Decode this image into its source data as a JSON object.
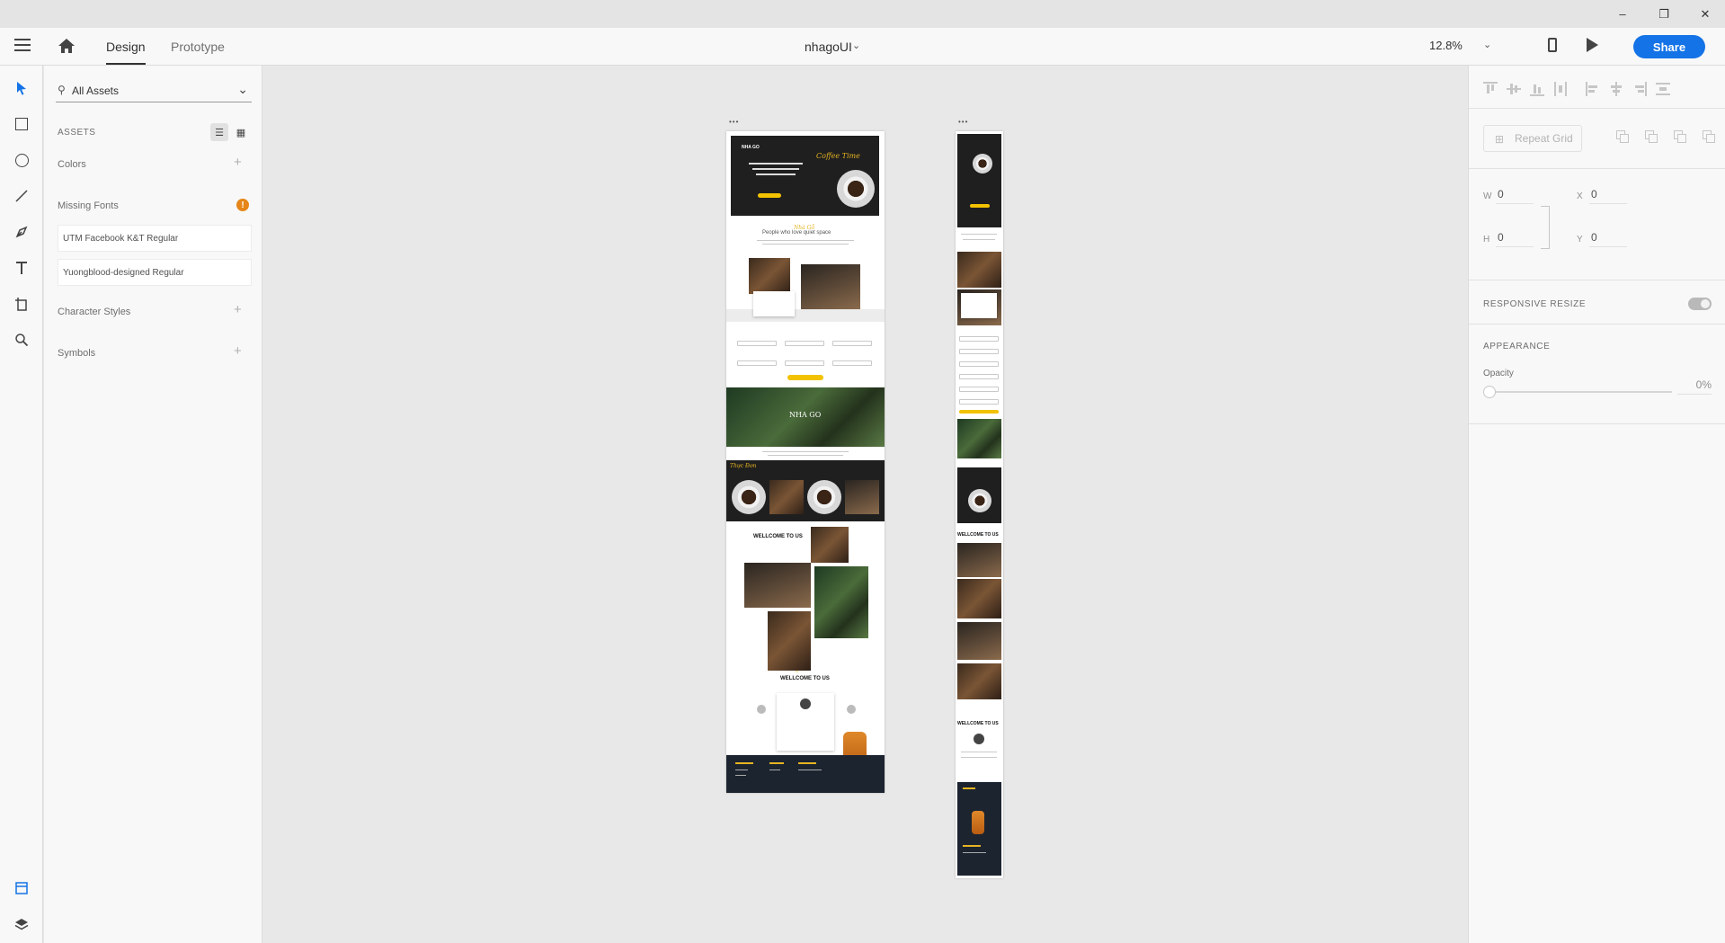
{
  "window": {
    "controls": {
      "minimize": "–",
      "restore": "❐",
      "close": "✕"
    }
  },
  "appbar": {
    "tabs": [
      {
        "label": "Design",
        "active": true
      },
      {
        "label": "Prototype",
        "active": false
      }
    ],
    "document_title": "nhagoUI",
    "zoom": "12.8%",
    "share_label": "Share",
    "accent_color": "#1473e6"
  },
  "toolbar": {
    "tools": [
      "select-tool",
      "rectangle-tool",
      "ellipse-tool",
      "line-tool",
      "pen-tool",
      "text-tool",
      "artboard-tool",
      "zoom-tool"
    ],
    "bottom": [
      "assets-panel",
      "layers-panel"
    ]
  },
  "assets": {
    "filter": "All Assets",
    "heading": "ASSETS",
    "colors_label": "Colors",
    "missing_fonts_label": "Missing Fonts",
    "missing_fonts": [
      "UTM Facebook K&T Regular",
      "Yuongblood-designed Regular"
    ],
    "character_styles_label": "Character Styles",
    "symbols_label": "Symbols",
    "warning_color": "#e68619"
  },
  "canvas": {
    "desktop_artboard": {
      "hero_script": "Coffee Time",
      "brand": "Nhà Gỗ",
      "tagline": "People who love quiet space",
      "logo": "NHA GO",
      "menu_title": "Thực Đơn",
      "welcome_1": "WELLCOME TO US",
      "welcome_2": "WELLCOME TO US"
    },
    "mobile_artboard": {
      "welcome_1": "WELLCOME TO US",
      "welcome_2": "WELLCOME TO US"
    }
  },
  "properties": {
    "repeat_grid_label": "Repeat Grid",
    "w_label": "W",
    "w_value": "0",
    "h_label": "H",
    "h_value": "0",
    "x_label": "X",
    "x_value": "0",
    "y_label": "Y",
    "y_value": "0",
    "responsive_resize_label": "RESPONSIVE RESIZE",
    "appearance_label": "APPEARANCE",
    "opacity_label": "Opacity",
    "opacity_value": "0%"
  }
}
